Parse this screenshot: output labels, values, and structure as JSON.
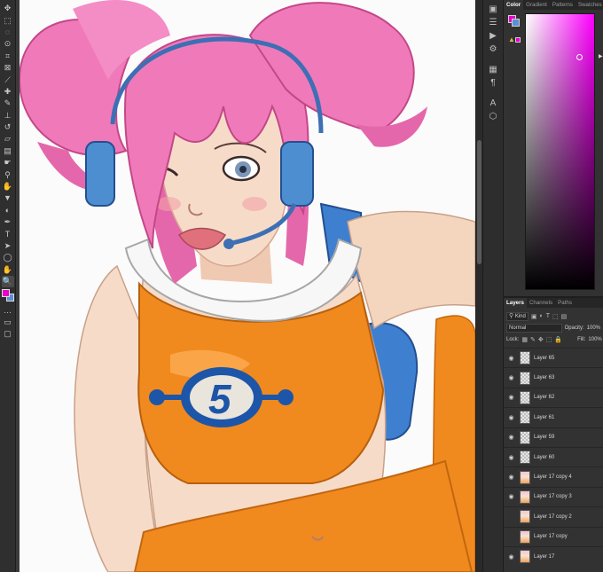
{
  "toolbar": {
    "tools": [
      {
        "name": "move-tool-icon",
        "glyph": "✥"
      },
      {
        "name": "marquee-tool-icon",
        "glyph": "⬚"
      },
      {
        "name": "lasso-tool-icon",
        "glyph": "◌"
      },
      {
        "name": "quick-select-tool-icon",
        "glyph": "⊙"
      },
      {
        "name": "crop-tool-icon",
        "glyph": "⌗"
      },
      {
        "name": "frame-tool-icon",
        "glyph": "⊠"
      },
      {
        "name": "eyedropper-tool-icon",
        "glyph": "⟋"
      },
      {
        "name": "healing-brush-tool-icon",
        "glyph": "✚"
      },
      {
        "name": "brush-tool-icon",
        "glyph": "✎"
      },
      {
        "name": "clone-stamp-tool-icon",
        "glyph": "⊥"
      },
      {
        "name": "history-brush-tool-icon",
        "glyph": "↺"
      },
      {
        "name": "eraser-tool-icon",
        "glyph": "▱"
      },
      {
        "name": "gradient-tool-icon",
        "glyph": "▤"
      },
      {
        "name": "smudge-tool-icon",
        "glyph": "☛"
      },
      {
        "name": "blur-tool-icon",
        "glyph": "⚲"
      },
      {
        "name": "dodge-tool-icon",
        "glyph": "✋"
      },
      {
        "name": "sharpen-tool-icon",
        "glyph": "▼"
      },
      {
        "name": "burn-tool-icon",
        "glyph": "◐"
      },
      {
        "name": "pen-tool-icon",
        "glyph": "✒"
      },
      {
        "name": "type-tool-icon",
        "glyph": "T"
      },
      {
        "name": "path-selection-tool-icon",
        "glyph": "➤"
      },
      {
        "name": "ellipse-tool-icon",
        "glyph": "◯"
      },
      {
        "name": "hand-tool-icon",
        "glyph": "✋"
      },
      {
        "name": "zoom-tool-icon",
        "glyph": "🔍"
      },
      {
        "name": "more-tools-icon",
        "glyph": "…"
      }
    ],
    "foreground_color": "#e600c8",
    "background_color": "#5b8fd8"
  },
  "dock": {
    "icons": [
      {
        "name": "history-panel-icon",
        "glyph": "▣"
      },
      {
        "name": "properties-panel-icon",
        "glyph": "☰"
      },
      {
        "name": "actions-panel-icon",
        "glyph": "▶"
      },
      {
        "name": "adjustments-panel-icon",
        "glyph": "⚙"
      },
      {
        "name": "libraries-panel-icon",
        "glyph": "▦"
      },
      {
        "name": "paragraph-panel-icon",
        "glyph": "¶"
      },
      {
        "name": "character-panel-icon",
        "glyph": "A"
      },
      {
        "name": "3d-panel-icon",
        "glyph": "⬡"
      }
    ]
  },
  "color_panel": {
    "tabs": [
      {
        "label": "Color",
        "active": true
      },
      {
        "label": "Gradient",
        "active": false
      },
      {
        "label": "Patterns",
        "active": false
      },
      {
        "label": "Swatches",
        "active": false
      }
    ],
    "foreground_color": "#e600c8",
    "background_color": "#5b8fd8",
    "hue_color": "#ff00ff"
  },
  "layers_panel": {
    "tabs": [
      {
        "label": "Layers",
        "active": true
      },
      {
        "label": "Channels",
        "active": false
      },
      {
        "label": "Paths",
        "active": false
      }
    ],
    "filter_label": "Kind",
    "blend_mode": "Normal",
    "opacity_label": "Opacity:",
    "opacity_value": "100%",
    "lock_label": "Lock:",
    "fill_label": "Fill:",
    "fill_value": "100%",
    "layers": [
      {
        "name": "Layer 65",
        "visible": true,
        "thumb": "empty"
      },
      {
        "name": "Layer 63",
        "visible": true,
        "thumb": "empty"
      },
      {
        "name": "Layer 62",
        "visible": true,
        "thumb": "empty"
      },
      {
        "name": "Layer 61",
        "visible": true,
        "thumb": "empty"
      },
      {
        "name": "Layer 59",
        "visible": true,
        "thumb": "empty"
      },
      {
        "name": "Layer 60",
        "visible": true,
        "thumb": "empty"
      },
      {
        "name": "Layer 17 copy 4",
        "visible": true,
        "thumb": "art"
      },
      {
        "name": "Layer 17 copy 3",
        "visible": true,
        "thumb": "art"
      },
      {
        "name": "Layer 17 copy 2",
        "visible": false,
        "thumb": "art"
      },
      {
        "name": "Layer 17 copy",
        "visible": false,
        "thumb": "art"
      },
      {
        "name": "Layer 17",
        "visible": true,
        "thumb": "art"
      }
    ]
  },
  "artwork": {
    "badge_number": "5",
    "colors": {
      "hair": "#f07ab9",
      "skin": "#f6dcc8",
      "top": "#f08a1e",
      "headset": "#4d8ed1",
      "backpack": "#3f7fd0",
      "logo": "#1d55a8"
    }
  }
}
